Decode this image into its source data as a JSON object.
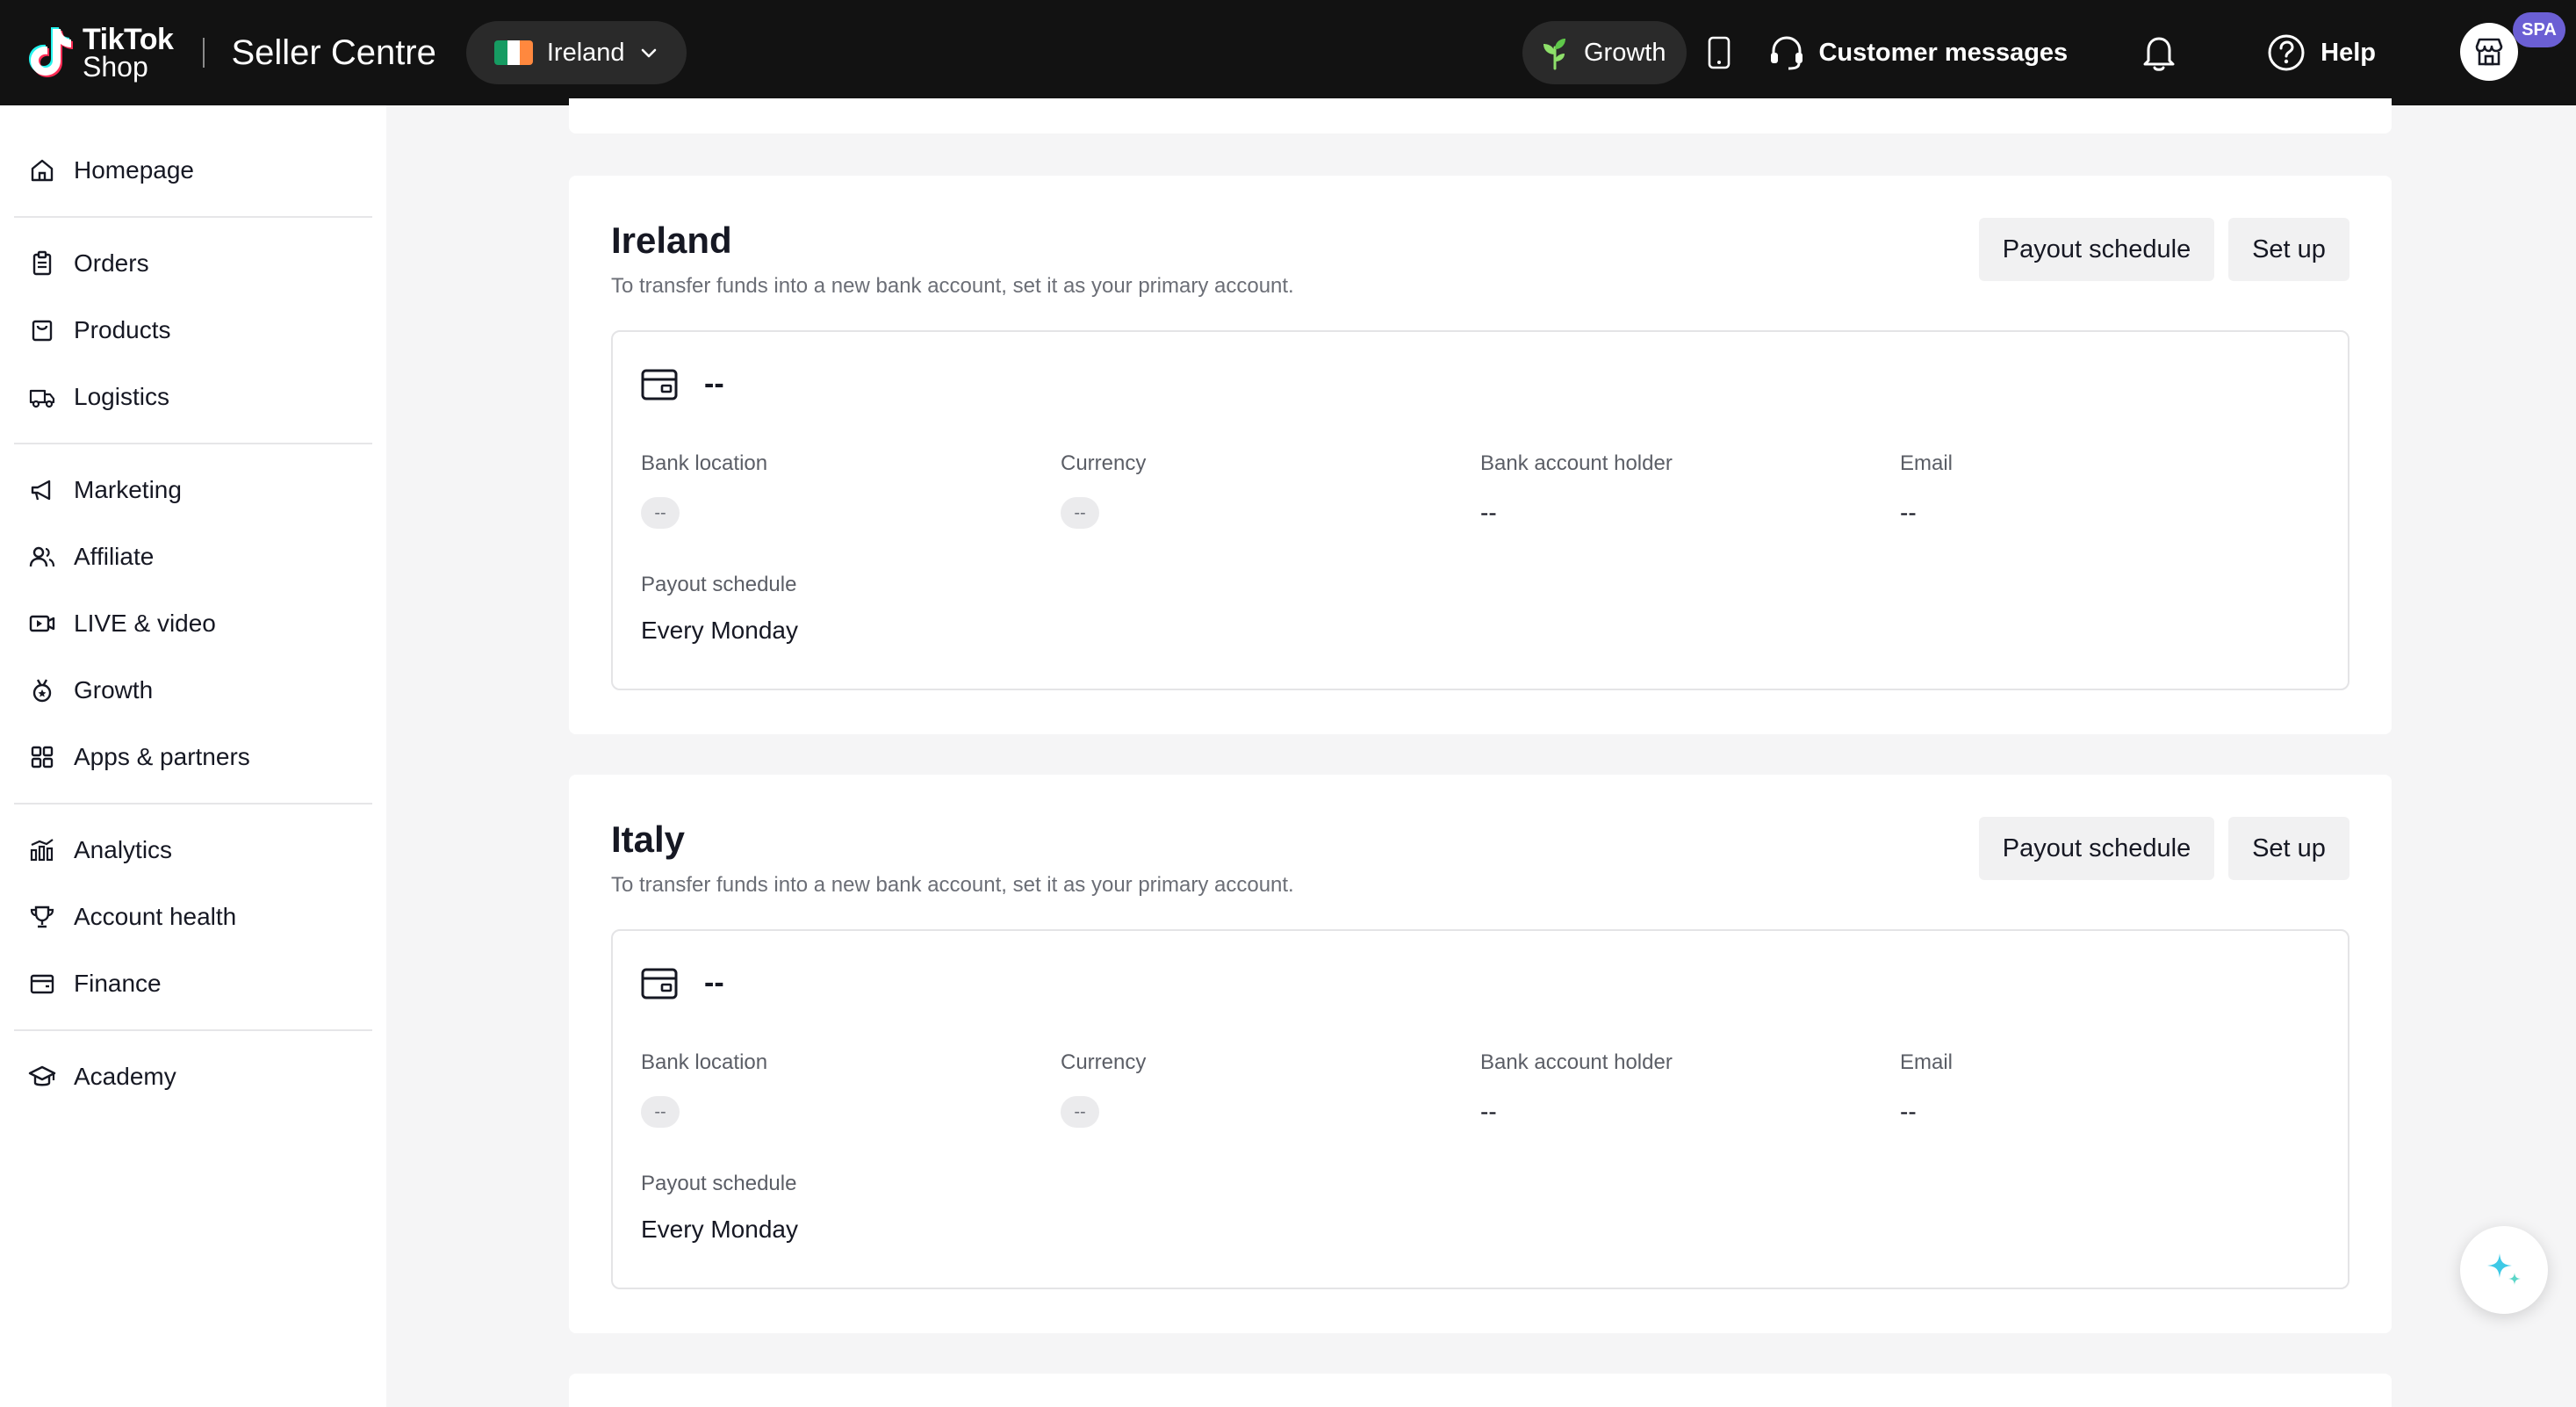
{
  "header": {
    "brand_line1": "TikTok",
    "brand_line2": "Shop",
    "title": "Seller Centre",
    "region": "Ireland",
    "growth_label": "Growth",
    "customer_messages_label": "Customer messages",
    "help_label": "Help",
    "avatar_badge": "SPA"
  },
  "sidebar": {
    "groups": [
      [
        {
          "label": "Homepage",
          "icon": "home-icon"
        }
      ],
      [
        {
          "label": "Orders",
          "icon": "clipboard-icon"
        },
        {
          "label": "Products",
          "icon": "bag-icon"
        },
        {
          "label": "Logistics",
          "icon": "truck-icon"
        }
      ],
      [
        {
          "label": "Marketing",
          "icon": "megaphone-icon"
        },
        {
          "label": "Affiliate",
          "icon": "users-icon"
        },
        {
          "label": "LIVE & video",
          "icon": "video-icon"
        },
        {
          "label": "Growth",
          "icon": "medal-icon"
        },
        {
          "label": "Apps & partners",
          "icon": "apps-icon"
        }
      ],
      [
        {
          "label": "Analytics",
          "icon": "bar-chart-icon"
        },
        {
          "label": "Account health",
          "icon": "trophy-icon"
        },
        {
          "label": "Finance",
          "icon": "wallet-icon"
        }
      ],
      [
        {
          "label": "Academy",
          "icon": "graduation-cap-icon"
        }
      ]
    ]
  },
  "cards": [
    {
      "country": "Ireland",
      "description": "To transfer funds into a new bank account, set it as your primary account.",
      "payout_schedule_button": "Payout schedule",
      "setup_button": "Set up",
      "account_name": "--",
      "fields": {
        "bank_location_label": "Bank location",
        "bank_location_value": "--",
        "currency_label": "Currency",
        "currency_value": "--",
        "holder_label": "Bank account holder",
        "holder_value": "--",
        "email_label": "Email",
        "email_value": "--",
        "payout_label": "Payout schedule",
        "payout_value": "Every Monday"
      }
    },
    {
      "country": "Italy",
      "description": "To transfer funds into a new bank account, set it as your primary account.",
      "payout_schedule_button": "Payout schedule",
      "setup_button": "Set up",
      "account_name": "--",
      "fields": {
        "bank_location_label": "Bank location",
        "bank_location_value": "--",
        "currency_label": "Currency",
        "currency_value": "--",
        "holder_label": "Bank account holder",
        "holder_value": "--",
        "email_label": "Email",
        "email_value": "--",
        "payout_label": "Payout schedule",
        "payout_value": "Every Monday"
      }
    }
  ],
  "colors": {
    "topbar": "#121212",
    "accent_teal": "#25f4ee",
    "accent_pink": "#fe2c55",
    "avatar_badge": "#6b5fd4"
  }
}
